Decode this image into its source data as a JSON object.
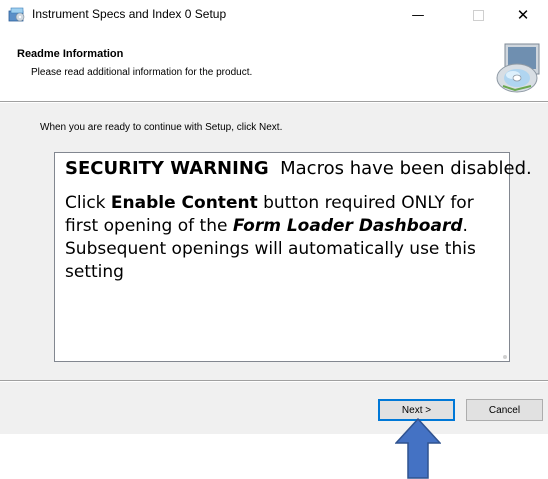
{
  "window": {
    "title": "Instrument Specs and Index 0 Setup",
    "minimize_glyph": "—",
    "close_glyph": "✕"
  },
  "header": {
    "title": "Readme Information",
    "subtitle": "Please read additional information for the product."
  },
  "intro_text": "When you are ready to continue with Setup, click Next.",
  "readme": {
    "warning_title": "SECURITY WARNING",
    "warning_message": "Macros have been disabled.",
    "line_prefix": "Click ",
    "enable_content": "Enable Content",
    "line_mid": " button required ONLY for first opening of the ",
    "dashboard_name": "Form Loader Dashboard",
    "line_end": ".  Subsequent openings will automatically use this setting"
  },
  "buttons": {
    "next": "Next >",
    "cancel": "Cancel"
  },
  "colors": {
    "focus_border": "#0078d7",
    "arrow_fill": "#4472c4",
    "arrow_stroke": "#2f528f"
  },
  "icons": {
    "app": "installer-icon",
    "header": "setup-disc-icon",
    "annotation": "blue-up-arrow"
  }
}
